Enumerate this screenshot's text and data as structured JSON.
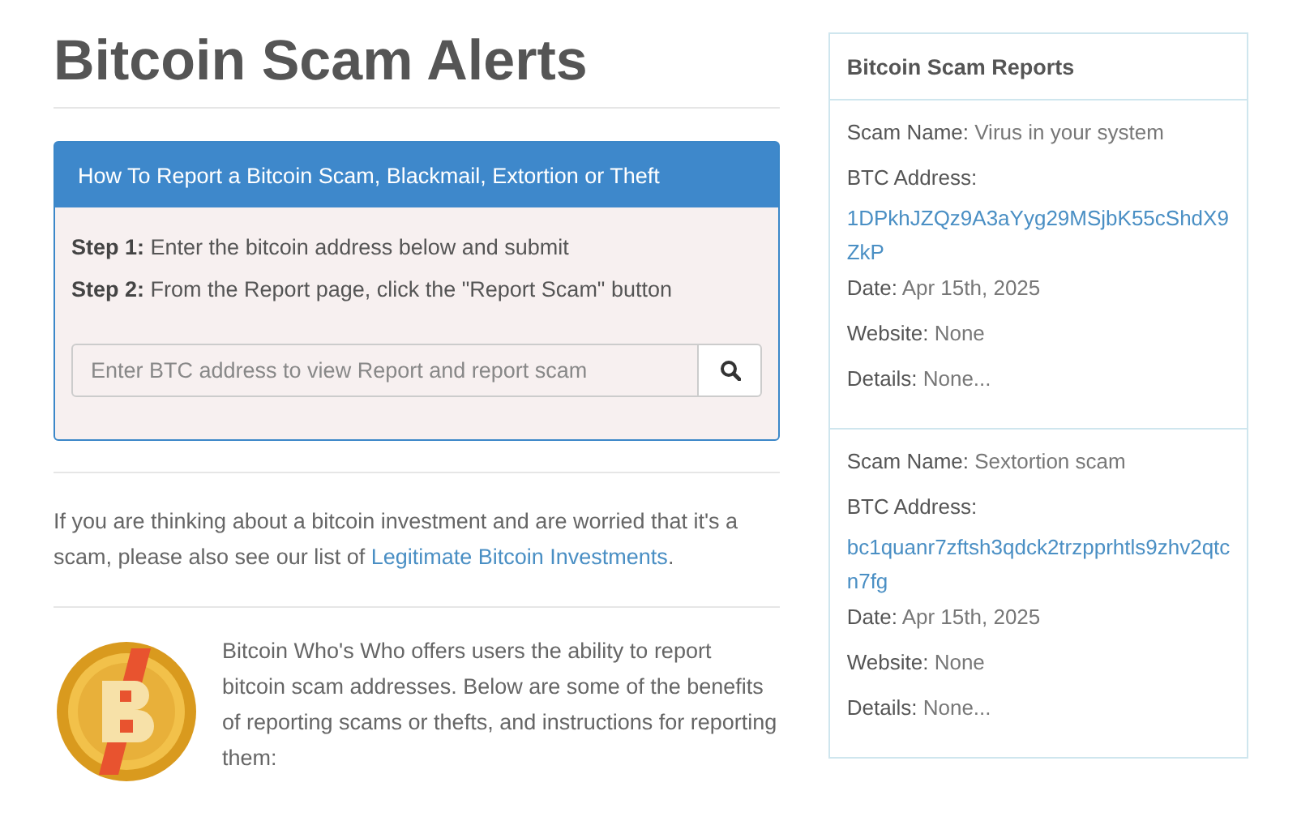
{
  "title": "Bitcoin Scam Alerts",
  "howto": {
    "heading": "How To Report a Bitcoin Scam, Blackmail, Extortion or Theft",
    "steps": [
      {
        "label": "Step 1:",
        "text": "Enter the bitcoin address below and submit"
      },
      {
        "label": "Step 2:",
        "text": "From the Report page, click the \"Report Scam\" button"
      }
    ],
    "search": {
      "placeholder": "Enter BTC address to view Report and report scam"
    }
  },
  "investment_note": {
    "text": "If you are thinking about a bitcoin investment and are worried that it's a scam, please also see our list of ",
    "link": "Legitimate Bitcoin Investments",
    "end": "."
  },
  "intro": "Bitcoin Who's Who offers users the ability to report bitcoin scam addresses. Below are some of the benefits of reporting scams or thefts, and instructions for reporting them:",
  "sidebar": {
    "title": "Bitcoin Scam Reports",
    "reports": [
      {
        "name_label": "Scam Name:",
        "name": "Virus in your system",
        "address_label": "BTC Address:",
        "address": "1DPkhJZQz9A3aYyg29MSjbK55cShdX9ZkP",
        "date_label": "Date:",
        "date": "Apr 15th, 2025",
        "website_label": "Website:",
        "website": "None",
        "details_label": "Details:",
        "details": "None..."
      },
      {
        "name_label": "Scam Name:",
        "name": "Sextortion scam",
        "address_label": "BTC Address:",
        "address": "bc1quanr7zftsh3qdck2trzpprhtls9zhv2qtcn7fg",
        "date_label": "Date:",
        "date": "Apr 15th, 2025",
        "website_label": "Website:",
        "website": "None",
        "details_label": "Details:",
        "details": "None..."
      }
    ]
  }
}
